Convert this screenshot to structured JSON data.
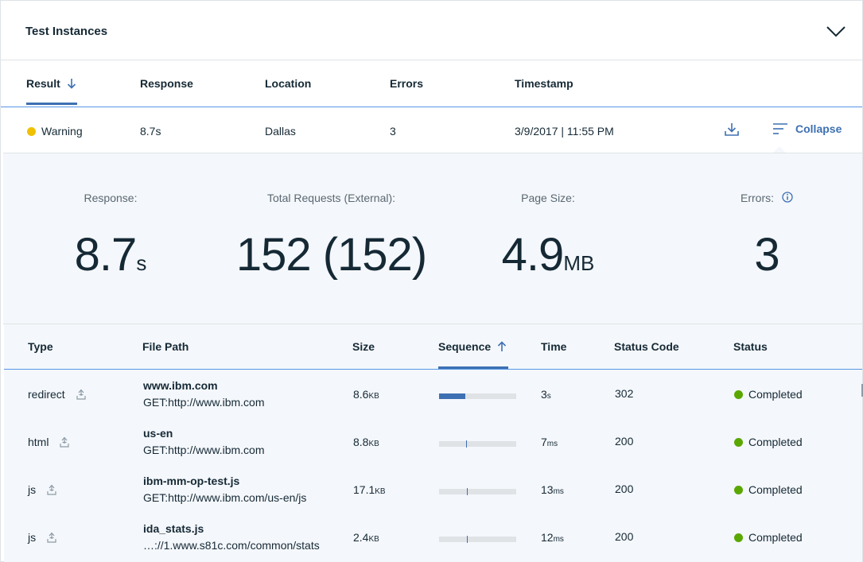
{
  "header": {
    "title": "Test Instances"
  },
  "colors": {
    "accent": "#3d70b2",
    "warning": "#efc100",
    "success": "#5aa700",
    "summary_bg": "#f4f7fb"
  },
  "results_table": {
    "columns": [
      "Result",
      "Response",
      "Location",
      "Errors",
      "Timestamp"
    ],
    "sorted_column": "Result",
    "row": {
      "status": "Warning",
      "response": "8.7s",
      "location": "Dallas",
      "errors": "3",
      "timestamp": "3/9/2017 | 11:55 PM",
      "collapse_label": "Collapse"
    }
  },
  "summary": {
    "response": {
      "label": "Response:",
      "value": "8.7",
      "unit": "s"
    },
    "requests": {
      "label": "Total Requests (External):",
      "value": "152 (152)"
    },
    "page_size": {
      "label": "Page Size:",
      "value": "4.9",
      "unit": "MB"
    },
    "errors": {
      "label": "Errors:",
      "value": "3"
    }
  },
  "requests_table": {
    "columns": [
      "Type",
      "File Path",
      "Size",
      "Sequence",
      "Time",
      "Status Code",
      "Status"
    ],
    "sorted_column": "Sequence",
    "rows": [
      {
        "type": "redirect",
        "name": "www.ibm.com",
        "url": "GET:http://www.ibm.com",
        "size": "8.6",
        "size_unit": "KB",
        "sequence": {
          "kind": "fill",
          "fraction": 0.34
        },
        "time": "3",
        "time_unit": "s",
        "code": "302",
        "status": "Completed"
      },
      {
        "type": "html",
        "name": "us-en",
        "url": "GET:http://www.ibm.com",
        "size": "8.8",
        "size_unit": "KB",
        "sequence": {
          "kind": "mark",
          "fraction": 0.35
        },
        "time": "7",
        "time_unit": "ms",
        "code": "200",
        "status": "Completed"
      },
      {
        "type": "js",
        "name": "ibm-mm-op-test.js",
        "url": "GET:http://www.ibm.com/us-en/js",
        "size": "17.1",
        "size_unit": "KB",
        "sequence": {
          "kind": "mark",
          "fraction": 0.36
        },
        "time": "13",
        "time_unit": "ms",
        "code": "200",
        "status": "Completed"
      },
      {
        "type": "js",
        "name": "ida_stats.js",
        "url": "…://1.www.s81c.com/common/stats",
        "size": "2.4",
        "size_unit": "KB",
        "sequence": {
          "kind": "mark",
          "fraction": 0.36
        },
        "time": "12",
        "time_unit": "ms",
        "code": "200",
        "status": "Completed"
      }
    ]
  }
}
